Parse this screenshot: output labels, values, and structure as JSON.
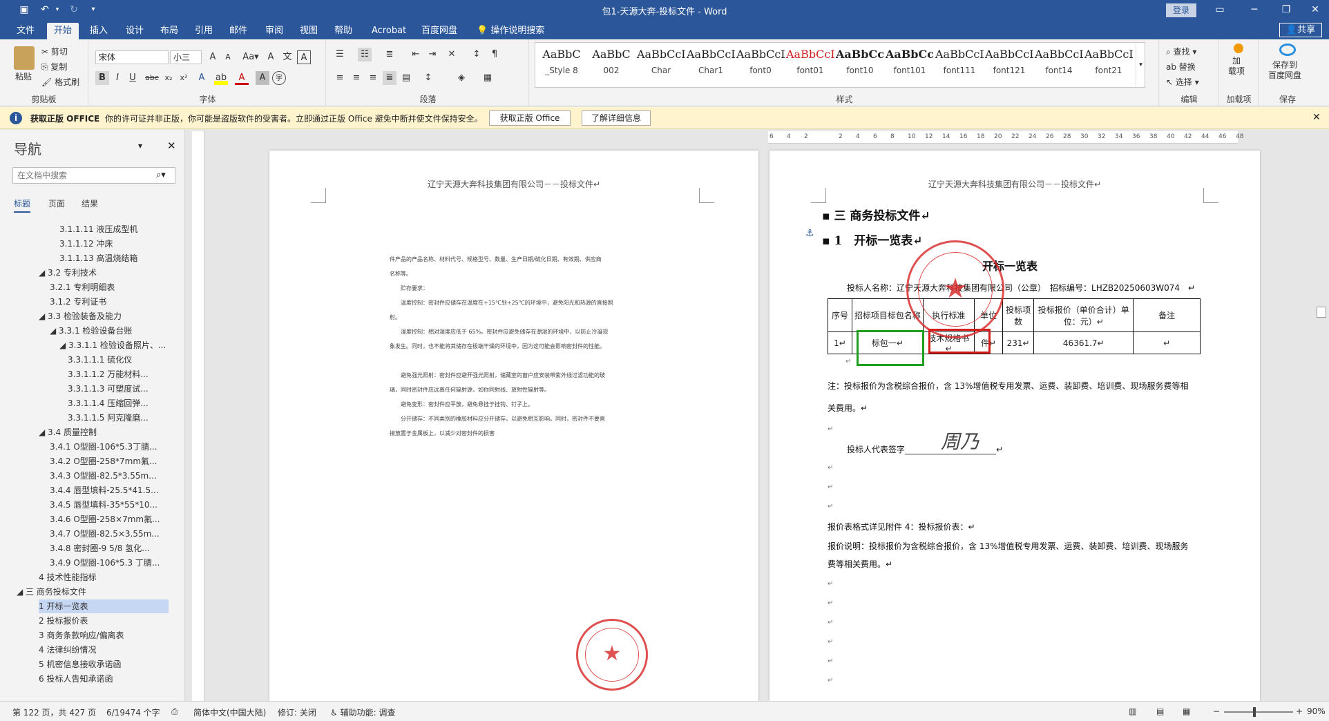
{
  "window": {
    "title": "包1-天源大奔-投标文件 - Word",
    "login_label": "登录",
    "share_label": "共享"
  },
  "tabs": [
    "文件",
    "开始",
    "插入",
    "设计",
    "布局",
    "引用",
    "邮件",
    "审阅",
    "视图",
    "帮助",
    "Acrobat",
    "百度网盘"
  ],
  "tell_me": "操作说明搜索",
  "ribbon": {
    "clipboard": {
      "paste": "粘贴",
      "cut": "剪切",
      "copy": "复制",
      "format_painter": "格式刷",
      "label": "剪贴板"
    },
    "font": {
      "name": "宋体",
      "size": "小三",
      "label": "字体"
    },
    "paragraph": {
      "label": "段落"
    },
    "styles": {
      "label": "样式",
      "items": [
        {
          "sample": "AaBbC",
          "name": "_Style 8"
        },
        {
          "sample": "AaBbC",
          "name": "002"
        },
        {
          "sample": "AaBbCcI",
          "name": "Char"
        },
        {
          "sample": "AaBbCcDc",
          "name": "Char1"
        },
        {
          "sample": "AaBbCcDc",
          "name": "font0"
        },
        {
          "sample": "AaBbCcDc",
          "name": "font01"
        },
        {
          "sample": "AaBbCcI",
          "name": "font10"
        },
        {
          "sample": "AaBbCcI",
          "name": "font101"
        },
        {
          "sample": "AaBbCcDc",
          "name": "font111"
        },
        {
          "sample": "AaBbCcL",
          "name": "font121"
        },
        {
          "sample": "AaBbCcL",
          "name": "font14"
        },
        {
          "sample": "AaBbCcL",
          "name": "font21"
        }
      ]
    },
    "editing": {
      "find": "查找",
      "replace": "替换",
      "select": "选择",
      "label": "编辑"
    },
    "addins": {
      "load": "加\n载项",
      "label": "加载项"
    },
    "save": {
      "save_baidu": "保存到\n百度网盘",
      "label": "保存"
    }
  },
  "infobar": {
    "title": "获取正版 OFFICE",
    "message": "你的许可证并非正版，你可能是盗版软件的受害者。立即通过正版 Office 避免中断并使文件保持安全。",
    "btn_get": "获取正版 Office",
    "btn_learn": "了解详细信息"
  },
  "nav": {
    "title": "导航",
    "search_placeholder": "在文档中搜索",
    "tabs": [
      "标题",
      "页面",
      "结果"
    ],
    "items": [
      {
        "text": "3.1.1.11 液压成型机",
        "level": 4
      },
      {
        "text": "3.1.1.12 冲床",
        "level": 4
      },
      {
        "text": "3.1.1.13 高温烧结箱",
        "level": 4
      },
      {
        "text": "◢  3.2 专利技术",
        "level": 2
      },
      {
        "text": "3.2.1 专利明细表",
        "level": 3
      },
      {
        "text": "3.1.2 专利证书",
        "level": 3
      },
      {
        "text": "◢  3.3 检验装备及能力",
        "level": 2
      },
      {
        "text": "◢  3.3.1 检验设备台账",
        "level": 3
      },
      {
        "text": "◢  3.3.1.1 检验设备照片、...",
        "level": 4
      },
      {
        "text": "3.3.1.1.1 硫化仪",
        "level": 5
      },
      {
        "text": "3.3.1.1.2 万能材料...",
        "level": 5
      },
      {
        "text": "3.3.1.1.3 可塑度试...",
        "level": 5
      },
      {
        "text": "3.3.1.1.4 压缩回弹...",
        "level": 5
      },
      {
        "text": "3.3.1.1.5 阿克隆磨...",
        "level": 5
      },
      {
        "text": "◢  3.4 质量控制",
        "level": 2
      },
      {
        "text": "3.4.1 O型圈-106*5.3丁腈...",
        "level": 3
      },
      {
        "text": "3.4.2 O型圈-258*7mm氟...",
        "level": 3
      },
      {
        "text": "3.4.3 O型圈-82.5*3.55m...",
        "level": 3
      },
      {
        "text": "3.4.4 唇型填料-25.5*41.5...",
        "level": 3
      },
      {
        "text": "3.4.5 唇型填料-35*55*10...",
        "level": 3
      },
      {
        "text": "3.4.6 O型圈-258×7mm氟...",
        "level": 3
      },
      {
        "text": "3.4.7 O型圈-82.5×3.55m...",
        "level": 3
      },
      {
        "text": "3.4.8 密封圈-9 5/8 氢化...",
        "level": 3
      },
      {
        "text": "3.4.9 O型圈-106*5.3 丁腈...",
        "level": 3
      },
      {
        "text": "4 技术性能指标",
        "level": 2
      },
      {
        "text": "◢  三 商务投标文件",
        "level": 1
      },
      {
        "text": "1 开标一览表",
        "level": 2,
        "selected": true
      },
      {
        "text": "2 投标报价表",
        "level": 2
      },
      {
        "text": "3 商务条款响应/偏离表",
        "level": 2
      },
      {
        "text": "4 法律纠纷情况",
        "level": 2
      },
      {
        "text": "5 机密信息接收承诺函",
        "level": 2
      },
      {
        "text": "6 投标人告知承诺函",
        "level": 2
      }
    ]
  },
  "left_page": {
    "header": "辽宁天源大奔科技集团有限公司－－投标文件↵",
    "lines": [
      "件产品的产品名称、材料代号、规格型号、数量、生产日期/硫化日期、有效期、供应商",
      "名称等。",
      "　　贮存要求：",
      "　　温度控制：密封件应储存在温度在+15℃到+25℃的环境中，避免阳光和热源的直接照",
      "射。",
      "　　湿度控制：相对湿度应低于 65%。密封件应避免储存在潮湿的环境中，以防止冷凝现",
      "象发生。同时，也不能将其储存在极端干燥的环境中，因为这可能会影响密封件的性能。",
      "",
      "　　避免强光照射：密封件应避开强光照射，储藏室的窗户应安装带紫外线过滤功能的玻",
      "璃，同时密封件应远离任何辐射源，如你同射线、放射性辐射等。",
      "　　避免变形：密封件应平放，避免悬挂于挂钩、钉子上。",
      "　　分开储存：不同类别的橡胶材料应分开储存，以避免相互影响。同时，密封件不要直",
      "接放置于金属板上，以减少对密封件的损害"
    ]
  },
  "right_page": {
    "header": "辽宁天源大奔科技集团有限公司－－投标文件↵",
    "heading1": "三 商务投标文件↵",
    "heading2": "1　开标一览表↵",
    "table_title": "开标一览表",
    "bidder_line": "投标人名称：辽宁天源大奔科技集团有限公司（公章）　招标编号：LHZB20250603W074　↵",
    "table_headers": [
      "序号",
      "招标项目标包名称",
      "执行标准",
      "单位",
      "投标项数",
      "投标报价（单价合计）单位：元）↵",
      "备注"
    ],
    "table_row": [
      "1↵",
      "标包一↵",
      "技术规格书↵",
      "件↵",
      "231↵",
      "46361.7↵",
      "↵"
    ],
    "note_line1": "注：投标报价为含税综合报价，含 13%增值税专用发票、运费、装卸费、培训费、现场服务费等相",
    "note_line2": "关费用。↵",
    "signature_label": "投标人代表签字",
    "signature_text": "周乃",
    "quote_ref": "报价表格式详见附件 4：投标报价表：↵",
    "quote_desc1": "报价说明：投标报价为含税综合报价，含 13%增值税专用发票、运费、装卸费、培训费、现场服务",
    "quote_desc2": "费等相关费用。↵"
  },
  "stamp": {
    "text": "LIAONING TIANYUAN DABEN TECHNOLOGY GROUP CO",
    "cn": "辽宁天源大奔科技集团有限公司"
  },
  "ruler_ticks": [
    "6",
    "4",
    "2",
    "",
    "2",
    "4",
    "6",
    "8",
    "10",
    "12",
    "14",
    "16",
    "18",
    "20",
    "22",
    "24",
    "26",
    "28",
    "30",
    "32",
    "34",
    "36",
    "38",
    "40",
    "42",
    "44",
    "46",
    "48"
  ],
  "status": {
    "page": "第 122 页，共 427 页",
    "words": "6/19474 个字",
    "lang": "简体中文(中国大陆)",
    "track": "修订: 关闭",
    "access": "辅助功能: 调查",
    "zoom": "90%"
  }
}
